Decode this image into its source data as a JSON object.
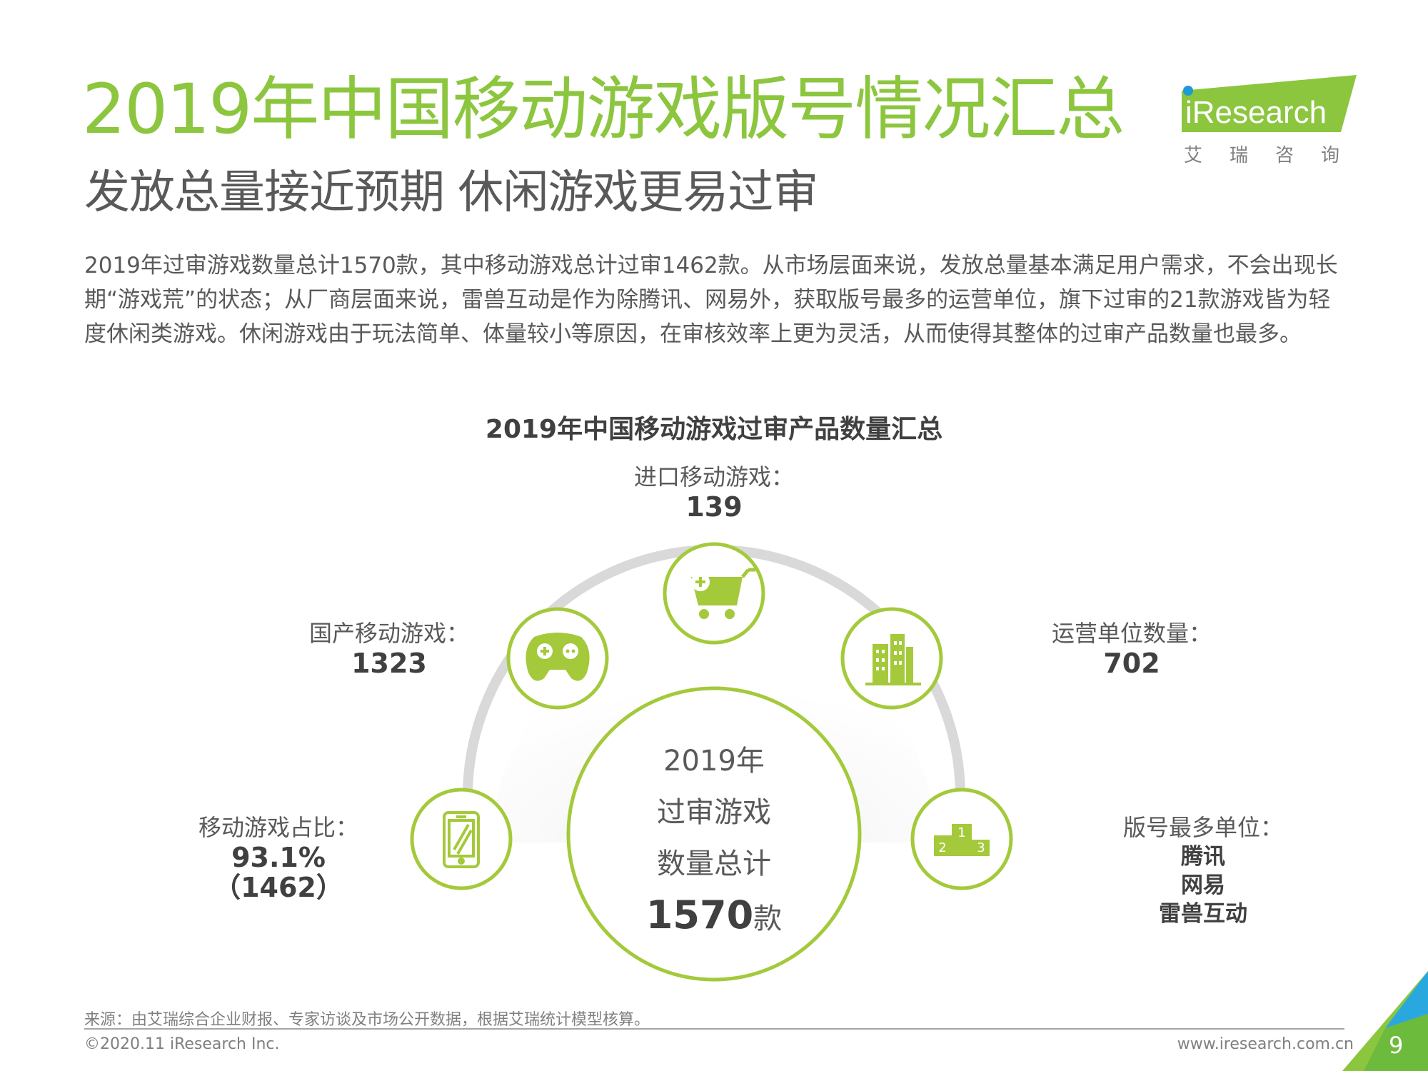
{
  "page": {
    "title": "2019年中国移动游戏版号情况汇总",
    "subtitle": "发放总量接近预期 休闲游戏更易过审",
    "body_text": "2019年过审游戏数量总计1570款，其中移动游戏总计过审1462款。从市场层面来说，发放总量基本满足用户需求，不会出现长期“游戏荒”的状态；从厂商层面来说，雷兽互动是作为除腾讯、网易外，获取版号最多的运营单位，旗下过审的21款游戏皆为轻度休闲类游戏。休闲游戏由于玩法简单、体量较小等原因，在审核效率上更为灵活，从而使得其整体的过审产品数量也最多。"
  },
  "logo": {
    "brand": "iResearch",
    "chinese": "艾瑞咨询"
  },
  "diagram": {
    "title": "2019年中国移动游戏过审产品数量汇总",
    "center": {
      "line1": "2019年",
      "line2": "过审游戏",
      "line3": "数量总计",
      "value": "1570",
      "unit": "款"
    },
    "nodes": [
      {
        "label": "移动游戏占比：",
        "value": "93.1%",
        "detail": "（1462）",
        "icon": "smartphone-icon"
      },
      {
        "label": "国产移动游戏：",
        "value": "1323",
        "icon": "gamepad-icon"
      },
      {
        "label": "进口移动游戏：",
        "value": "139",
        "icon": "shopping-cart-icon"
      },
      {
        "label": "运营单位数量：",
        "value": "702",
        "icon": "buildings-icon"
      },
      {
        "label": "版号最多单位：",
        "values": [
          "腾讯",
          "网易",
          "雷兽互动"
        ],
        "icon": "podium-icon",
        "podium": [
          "1",
          "2",
          "3"
        ]
      }
    ]
  },
  "footer": {
    "source": "来源：由艾瑞综合企业财报、专家访谈及市场公开数据，根据艾瑞统计模型核算。",
    "copyright": "©2020.11 iResearch Inc.",
    "website": "www.iresearch.com.cn",
    "page_number": "9"
  },
  "colors": {
    "accent": "#8cc63f",
    "ring": "#a4c93a",
    "arc": "#d9d9d9",
    "text": "#595959",
    "dark_text": "#404040"
  }
}
